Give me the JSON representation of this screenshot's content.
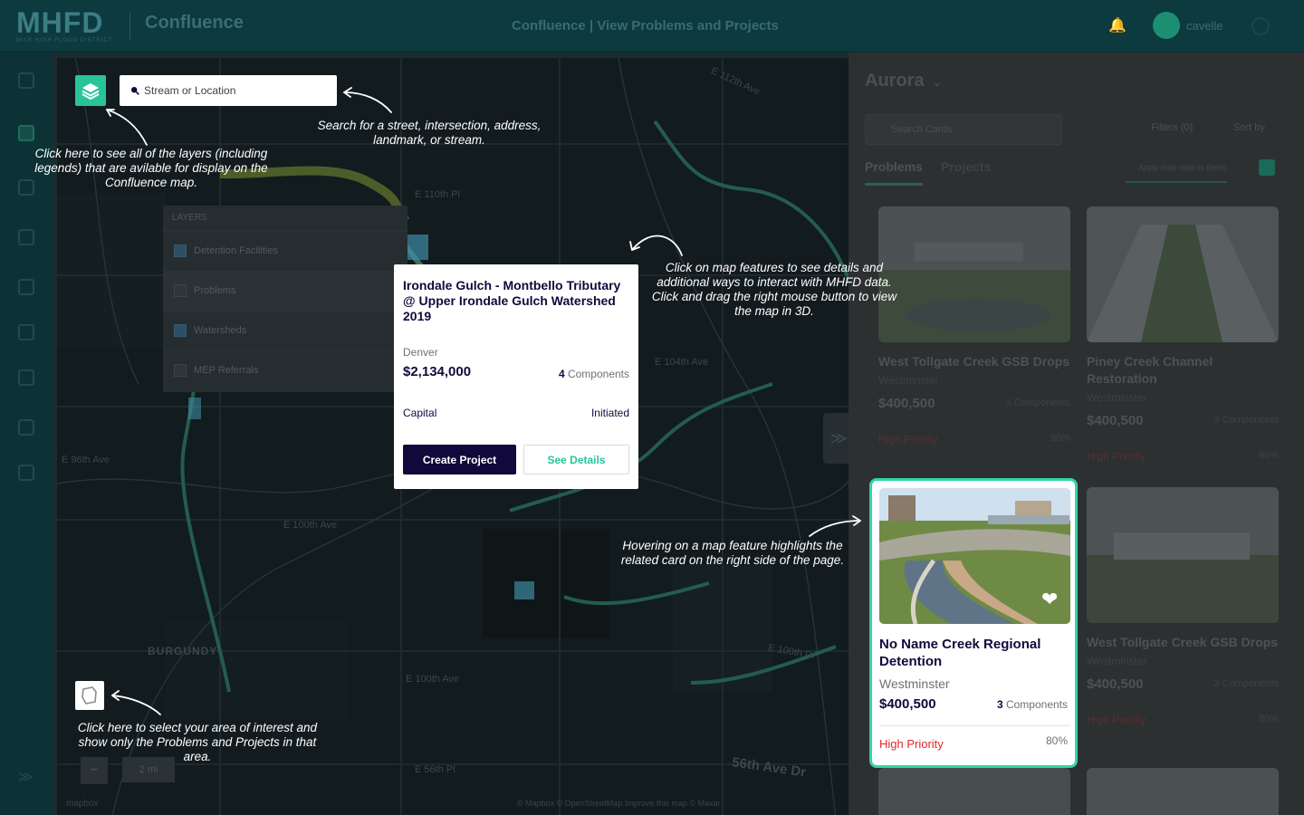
{
  "header": {
    "logo": "MHFD",
    "logo_sub": "MILE HIGH FLOOD DISTRICT",
    "app_name": "Confluence",
    "center_title": "Confluence  |  View Problems and Projects",
    "username": "cavelle"
  },
  "map": {
    "search_placeholder": "Stream or Location",
    "layers_title": "LAYERS",
    "layers": [
      {
        "name": "Detention Facilities",
        "checked": true
      },
      {
        "name": "Problems",
        "checked": false
      },
      {
        "name": "Watersheds",
        "checked": true
      },
      {
        "name": "MEP Referrals",
        "checked": false
      }
    ],
    "street_labels": [
      "E 112th Ave",
      "E 110th Pl",
      "E 104th Ave",
      "E 100th Ave",
      "E 96th Ave",
      "E 100th Dr",
      "E 100th Ave",
      "BURGUNDY",
      "56th Ave Dr",
      "E 56th Pl"
    ],
    "scale_label": "2 mi",
    "attribution": "© Mapbox © OpenStreetMap  Improve this map  © Maxar",
    "mapbox": "mapbox"
  },
  "popup": {
    "title": "Irondale Gulch - Montbello Tributary @ Upper Irondale Gulch Watershed 2019",
    "city": "Denver",
    "price": "$2,134,000",
    "components_count": "4",
    "components_label": " Components",
    "type": "Capital",
    "status": "Initiated",
    "create_label": "Create Project",
    "details_label": "See Details"
  },
  "right_panel": {
    "title": "Aurora",
    "search_placeholder": "Search Cards",
    "filters_label": "Filters (0)",
    "sort_label": "Sort by",
    "tabs": [
      "Problems",
      "Projects"
    ],
    "apply_label": "Apply map view to filters",
    "cards": [
      {
        "title": "West Tollgate Creek GSB Drops",
        "city": "Westminster",
        "price": "$400,500",
        "components": "3 Components",
        "priority": "High Priority",
        "pct": "80%"
      },
      {
        "title": "Piney Creek Channel Restoration",
        "city": "Westminster",
        "price": "$400,500",
        "components": "3 Components",
        "priority": "High Priority",
        "pct": "80%"
      },
      {
        "title": "West Tollgate Creek GSB Drops",
        "city": "Westminster",
        "price": "$400,500",
        "components": "3 Components",
        "priority": "High Priority",
        "pct": "80%"
      }
    ],
    "highlighted_card": {
      "title": "No Name Creek Regional Detention",
      "city": "Westminster",
      "price": "$400,500",
      "components_count": "3",
      "components_label": " Components",
      "priority": "High Priority",
      "pct": "80%"
    }
  },
  "annotations": {
    "layers": "Click here to see all of the layers (including legends) that are avilable for display on the Confluence map.",
    "search": "Search for a street, intersection, address, landmark, or stream.",
    "map_features": "Click on map features to see details and additional ways to interact with MHFD data. Click and drag the right mouse button to view the map in 3D.",
    "hover": "Hovering on a map feature highlights the related card on the right side of the page.",
    "area": "Click here to select your area of interest and show only the Problems and Projects in that area."
  },
  "colors": {
    "accent": "#29c499",
    "navy": "#11093c",
    "priority_red": "#e0282d",
    "highlight_border": "#2fd6a7"
  },
  "icons": [
    "layers-icon",
    "search-icon",
    "polygon-select-icon",
    "heart-icon",
    "bell-icon",
    "chevron-down-icon",
    "collapse-arrow-icon"
  ]
}
